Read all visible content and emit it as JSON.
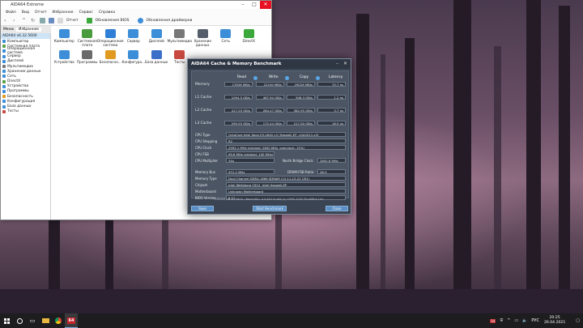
{
  "main_window": {
    "title": "AIDA64 Extreme",
    "menu": [
      "Файл",
      "Вид",
      "Отчет",
      "Избранное",
      "Сервис",
      "Справка"
    ],
    "toolbar": {
      "report": "Отчет",
      "bios_update": "Обновления BIOS",
      "driver_update": "Обновления драйверов"
    },
    "tabs": [
      "Меню",
      "Избранное"
    ],
    "sidebar_root": "AIDA64 v6.32.5600",
    "sidebar_items": [
      {
        "label": "Компьютер",
        "color": "#3c8ed8"
      },
      {
        "label": "Системная плата",
        "color": "#5aa04a"
      },
      {
        "label": "Операционная система",
        "color": "#3c8ed8"
      },
      {
        "label": "Сервер",
        "color": "#3c8ed8"
      },
      {
        "label": "Дисплей",
        "color": "#3c8ed8"
      },
      {
        "label": "Мультимедиа",
        "color": "#777777"
      },
      {
        "label": "Хранение данных",
        "color": "#3c8ed8"
      },
      {
        "label": "Сеть",
        "color": "#3c8ed8"
      },
      {
        "label": "DirectX",
        "color": "#5aa04a"
      },
      {
        "label": "Устройства",
        "color": "#3c8ed8"
      },
      {
        "label": "Программы",
        "color": "#3c8ed8"
      },
      {
        "label": "Безопасность",
        "color": "#e09a20"
      },
      {
        "label": "Конфигурация",
        "color": "#3c8ed8"
      },
      {
        "label": "База данных",
        "color": "#3c8ed8"
      },
      {
        "label": "Тесты",
        "color": "#c84a40"
      }
    ],
    "grid_icons": [
      {
        "label": "Компьютер",
        "color": "#3c8ed8"
      },
      {
        "label": "Системная плата",
        "color": "#4a9a3e"
      },
      {
        "label": "Операционная система",
        "color": "#2f7fd6"
      },
      {
        "label": "Сервер",
        "color": "#3c8ed8"
      },
      {
        "label": "Дисплей",
        "color": "#3c8ed8"
      },
      {
        "label": "Мультимедиа",
        "color": "#777777"
      },
      {
        "label": "Хранение данных",
        "color": "#555e6a"
      },
      {
        "label": "Сеть",
        "color": "#3c8ed8"
      },
      {
        "label": "DirectX",
        "color": "#3aa83a"
      },
      {
        "label": "Устройства",
        "color": "#3c8ed8"
      },
      {
        "label": "Программы",
        "color": "#6a6a6a"
      },
      {
        "label": "Безопасно...",
        "color": "#e09a20"
      },
      {
        "label": "Конфигура...",
        "color": "#3c8ed8"
      },
      {
        "label": "База данных",
        "color": "#3c70c8"
      },
      {
        "label": "Тесты",
        "color": "#c84a40"
      }
    ]
  },
  "benchmark": {
    "title": "AIDA64 Cache & Memory Benchmark",
    "columns": [
      "Read",
      "Write",
      "Copy",
      "Latency"
    ],
    "rows": [
      {
        "label": "Memory",
        "values": [
          "27836 MB/s",
          "22249 MB/s",
          "29028 MB/s",
          "70.7 ns"
        ]
      },
      {
        "label": "L1 Cache",
        "values": [
          "1094.5 GB/s",
          "467.94 GB/s",
          "946.3 GB/s",
          "1.2 ns"
        ]
      },
      {
        "label": "L2 Cache",
        "values": [
          "417.25 GB/s",
          "284.47 GB/s",
          "382.95 GB/s",
          "3.7 ns"
        ]
      },
      {
        "label": "L3 Cache",
        "values": [
          "299.55 GB/s",
          "175.44 GB/s",
          "217.00 GB/s",
          "16.5 ns"
        ]
      }
    ],
    "info": {
      "cpu_type_label": "CPU Type",
      "cpu_type": "OctaCore Intel Xeon E5-2640 v3 (Haswell-EP, LGA2011-v3)",
      "cpu_stepping_label": "CPU Stepping",
      "cpu_stepping": "R2",
      "cpu_clock_label": "CPU Clock",
      "cpu_clock": "2992.1 MHz (original: 2600 MHz, overclock: 15%)",
      "cpu_fsb_label": "CPU FSB",
      "cpu_fsb": "99.6 MHz (original: 100 MHz)",
      "cpu_mult_label": "CPU Multiplier",
      "cpu_mult": "34x",
      "nb_clock_label": "North Bridge Clock",
      "nb_clock": "2892.8 MHz",
      "mem_bus_label": "Memory Bus",
      "mem_bus": "931.2 MHz",
      "dram_ratio_label": "DRAM:FSB Ratio",
      "dram_ratio": "28:3",
      "mem_type_label": "Memory Type",
      "mem_type": "Dual Channel DDR4-1866 SDRAM (13-11-13-22 CR1)",
      "chipset_label": "Chipset",
      "chipset": "Intel Wellsburg C612, Intel Haswell-EP",
      "motherboard_label": "Motherboard",
      "motherboard": "Unknown Motherboard",
      "bios_label": "BIOS Version",
      "bios": "5.11"
    },
    "footer": "AIDA64 v6.32.5600 / BenchDLL 4.5.841.8-x64  (c) 1995-2020 FinalWire Ltd.",
    "buttons": {
      "save": "Save",
      "start": "Start Benchmark",
      "close": "Close"
    }
  },
  "taskbar": {
    "time": "20:25",
    "date": "26.04.2021",
    "lang": "РУС",
    "aida_badge": "64"
  }
}
